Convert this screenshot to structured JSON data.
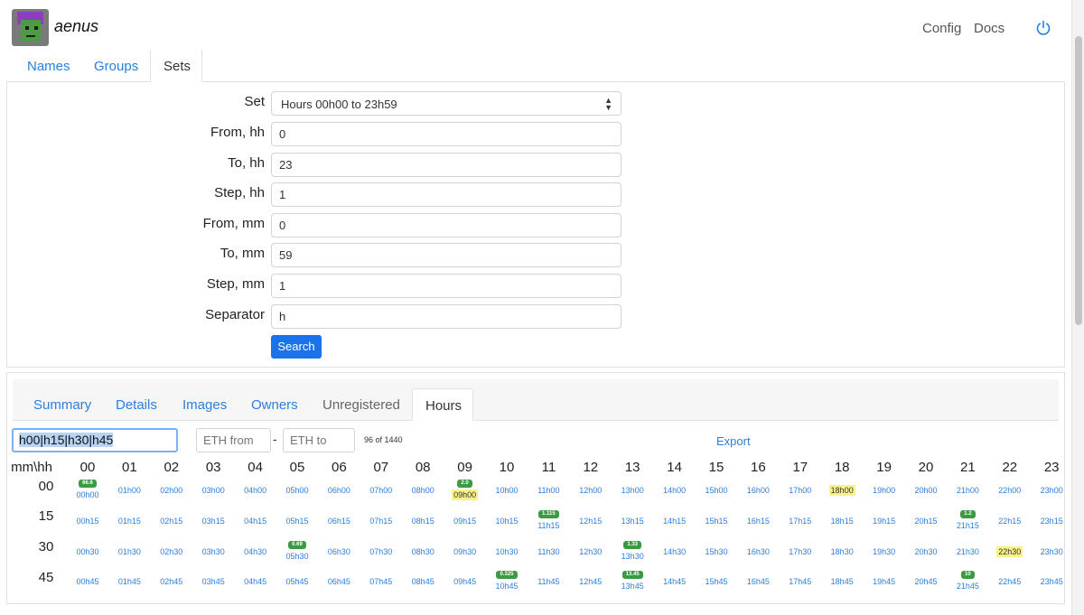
{
  "header": {
    "brand": "aenus",
    "nav": [
      "Config",
      "Docs"
    ]
  },
  "tabs": [
    "Names",
    "Groups",
    "Sets"
  ],
  "active_tab": "Sets",
  "form": {
    "set_label": "Set",
    "set_value": "Hours 00h00 to 23h59",
    "fields": [
      {
        "label": "From, hh",
        "value": "0"
      },
      {
        "label": "To, hh",
        "value": "23"
      },
      {
        "label": "Step, hh",
        "value": "1"
      },
      {
        "label": "From, mm",
        "value": "0"
      },
      {
        "label": "To, mm",
        "value": "59"
      },
      {
        "label": "Step, mm",
        "value": "1"
      },
      {
        "label": "Separator",
        "value": "h"
      }
    ],
    "search_label": "Search"
  },
  "results_tabs": [
    "Summary",
    "Details",
    "Images",
    "Owners",
    "Unregistered",
    "Hours"
  ],
  "results_active_tab": "Hours",
  "toolbar": {
    "filter_value": "h00|h15|h30|h45",
    "eth_from_placeholder": "ETH from",
    "eth_to_placeholder": "ETH to",
    "dash": "-",
    "count": "96 of 1440",
    "export_label": "Export"
  },
  "grid": {
    "corner": "mm\\hh",
    "hours": [
      "00",
      "01",
      "02",
      "03",
      "04",
      "05",
      "06",
      "07",
      "08",
      "09",
      "10",
      "11",
      "12",
      "13",
      "14",
      "15",
      "16",
      "17",
      "18",
      "19",
      "20",
      "21",
      "22",
      "23"
    ],
    "minutes": [
      "00",
      "15",
      "30",
      "45"
    ],
    "highlighted": [
      "09h00",
      "18h00",
      "22h30"
    ],
    "badges": {
      "00h00": "66.6",
      "09h00": "2.0",
      "11h15": "1.115",
      "21h15": "1.2",
      "05h30": "0.69",
      "13h30": "1.33",
      "10h45": "0.325",
      "13h45": "13.45",
      "21h45": "10"
    },
    "colors": {
      "badge": "#3c9a43",
      "link": "#2a7fe0",
      "highlight": "#f7f28a"
    }
  }
}
